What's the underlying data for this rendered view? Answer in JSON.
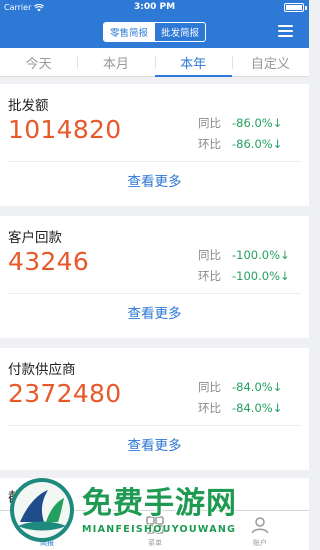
{
  "status_bar": {
    "carrier": "Carrier",
    "time": "3:00 PM"
  },
  "header": {
    "segments": {
      "retail": "零售简报",
      "wholesale": "批发简报"
    },
    "selected_segment": "retail"
  },
  "tabs": [
    {
      "label": "今天"
    },
    {
      "label": "本月"
    },
    {
      "label": "本年"
    },
    {
      "label": "自定义"
    }
  ],
  "active_tab": "本年",
  "cards": [
    {
      "title": "批发额",
      "value": "1014820",
      "yoy_label": "同比",
      "yoy": "-86.0%↓",
      "mom_label": "环比",
      "mom": "-86.0%↓",
      "more": "查看更多"
    },
    {
      "title": "客户回款",
      "value": "43246",
      "yoy_label": "同比",
      "yoy": "-100.0%↓",
      "mom_label": "环比",
      "mom": "-100.0%↓",
      "more": "查看更多"
    },
    {
      "title": "付款供应商",
      "value": "2372480",
      "yoy_label": "同比",
      "yoy": "-84.0%↓",
      "mom_label": "环比",
      "mom": "-84.0%↓",
      "more": "查看更多"
    }
  ],
  "peek_card": {
    "title": "截"
  },
  "bottom_nav": [
    {
      "label": "简报",
      "icon": "chart-icon"
    },
    {
      "label": "菜单",
      "icon": "grid-icon"
    },
    {
      "label": "账户",
      "icon": "user-icon"
    }
  ],
  "watermark": {
    "cn": "免费手游网",
    "en": "MIANFEISHOUYOUWANG"
  },
  "colors": {
    "brand_blue": "#2e78d6",
    "value_orange": "#e8582a",
    "change_green": "#23a060"
  }
}
